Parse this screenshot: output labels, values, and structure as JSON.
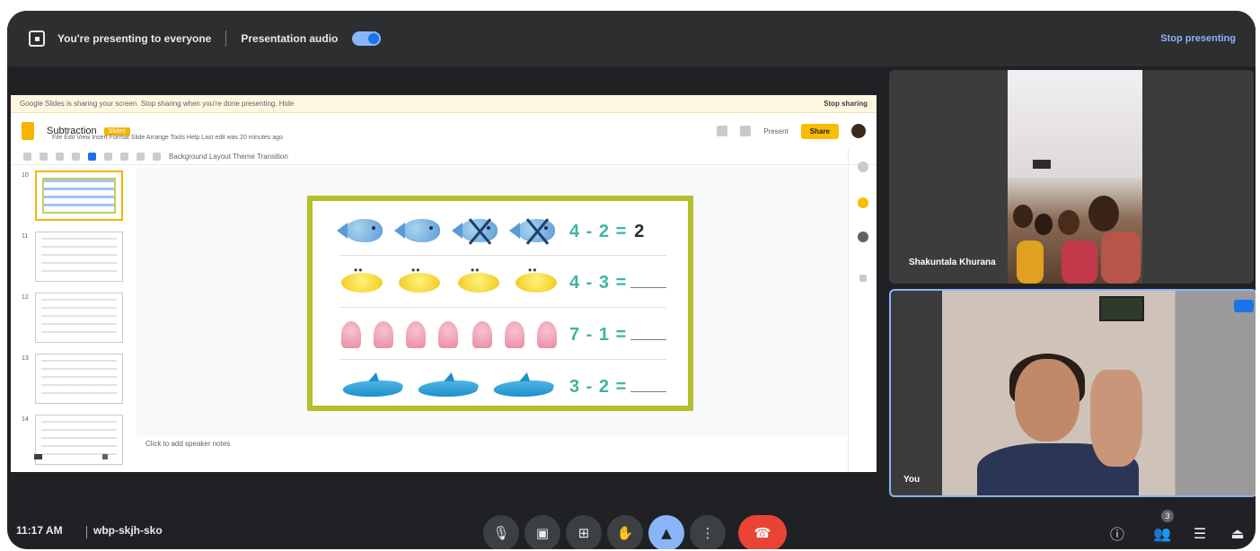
{
  "presenting_bar": {
    "status_text": "You're presenting to everyone",
    "audio_label": "Presentation audio",
    "audio_on": true,
    "stop_label": "Stop presenting"
  },
  "shared_screen": {
    "banner_text": "Google Slides is sharing your screen. Stop sharing when you're done presenting. Hide",
    "banner_right": "Stop sharing",
    "doc_title": "Subtraction",
    "doc_badge": "Slides",
    "menus": "File  Edit  View  Insert  Format  Slide  Arrange  Tools  Help  Last edit was 20 minutes ago",
    "share_label": "Share",
    "present_label": "Present",
    "toolbar_text": "Background   Layout   Theme   Transition",
    "speaker_notes": "Click to add speaker notes",
    "thumbnail_numbers": [
      "10",
      "11",
      "12",
      "13",
      "14"
    ]
  },
  "slide": {
    "equations": [
      {
        "text": "4 - 2 =",
        "answer": "2",
        "item": "fish",
        "count": 4,
        "crossed": 2
      },
      {
        "text": "4 - 3 =",
        "answer": "",
        "item": "submarine",
        "count": 4,
        "crossed": 0
      },
      {
        "text": "7 - 1 =",
        "answer": "",
        "item": "jellyfish",
        "count": 7,
        "crossed": 0
      },
      {
        "text": "3 - 2 =",
        "answer": "",
        "item": "dolphin",
        "count": 3,
        "crossed": 0
      }
    ]
  },
  "participants": {
    "remote_name": "Shakuntala Khurana",
    "self_name": "You"
  },
  "bottom_bar": {
    "time": "11:17 AM",
    "meeting_code": "wbp-skjh-sko",
    "people_count": "3",
    "controls": [
      {
        "name": "mic",
        "glyph": "🎙"
      },
      {
        "name": "camera",
        "glyph": "▣"
      },
      {
        "name": "captions",
        "glyph": "⊞"
      },
      {
        "name": "raise-hand",
        "glyph": "✋"
      },
      {
        "name": "present",
        "glyph": "▲"
      },
      {
        "name": "more-options",
        "glyph": "⋮"
      }
    ],
    "right_controls": [
      {
        "name": "info",
        "glyph": "ⓘ"
      },
      {
        "name": "people",
        "glyph": "👥"
      },
      {
        "name": "chat",
        "glyph": "☰"
      },
      {
        "name": "activities",
        "glyph": "⏏"
      }
    ]
  },
  "colors": {
    "meet_background": "#202124",
    "accent_blue": "#8ab4f8",
    "end_call_red": "#ea4335",
    "slide_border": "#b5bf2b",
    "equation_teal": "#3cb5a4"
  }
}
